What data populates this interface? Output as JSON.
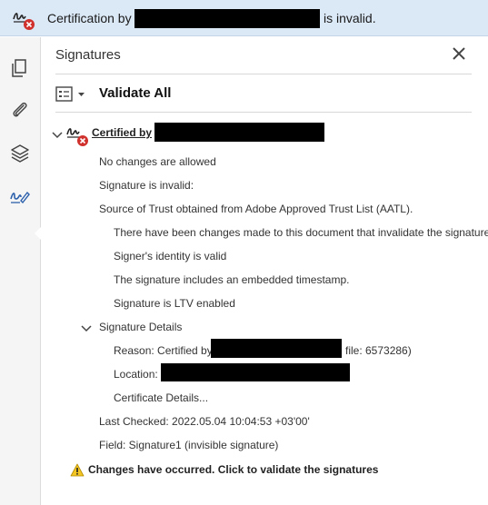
{
  "banner": {
    "icon": "signature-invalid-icon",
    "prefix": "Certification by",
    "suffix": "is invalid."
  },
  "sidebar": {
    "tools": [
      {
        "name": "pages-icon"
      },
      {
        "name": "attachments-icon"
      },
      {
        "name": "layers-icon"
      },
      {
        "name": "signatures-icon",
        "active": true
      }
    ]
  },
  "panel": {
    "title": "Signatures",
    "close_icon": "close-icon",
    "validate_all_label": "Validate All"
  },
  "signature": {
    "label": "Certified by",
    "icon": "signature-invalid-icon",
    "lines": {
      "changes_allowed": "No changes are allowed",
      "validity": "Signature is invalid:",
      "trust_source": "Source of Trust obtained from Adobe Approved Trust List (AATL).",
      "changes_made": "There have been changes made to this document that invalidate the signature.",
      "identity": "Signer's identity is valid",
      "timestamp": "The signature includes an embedded timestamp.",
      "ltv": "Signature is LTV enabled"
    },
    "details": {
      "heading": "Signature Details",
      "reason_prefix": "Reason: Certified by",
      "reason_suffix": "file: 6573286)",
      "location_prefix": "Location:",
      "certificate_details": "Certificate Details..."
    },
    "last_checked": "Last Checked: 2022.05.04 10:04:53 +03'00'",
    "field": "Field: Signature1 (invisible signature)"
  },
  "warning": {
    "icon": "warning-icon",
    "text": "Changes have occurred. Click to validate the signatures"
  },
  "colors": {
    "banner_bg": "#dbe8f6",
    "error_red": "#d0312d",
    "icon_blue": "#2b5fab",
    "warning_yellow": "#f3c623"
  }
}
